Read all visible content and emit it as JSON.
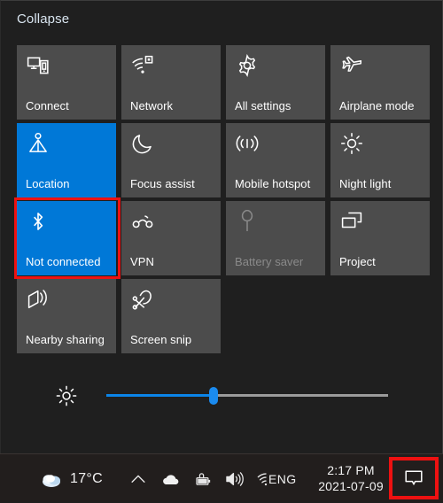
{
  "action_center": {
    "collapse_label": "Collapse",
    "colors": {
      "panel_background": "#1f1f1f",
      "tile_off": "#4c4c4c",
      "tile_on": "#0078d7",
      "accent": "#0078d7",
      "highlight_box": "#ee1111",
      "disabled_text": "#8a8a8a"
    },
    "tiles": [
      {
        "label": "Connect",
        "icon": "connect-icon",
        "state": "off"
      },
      {
        "label": "Network",
        "icon": "network-wifi-icon",
        "state": "off"
      },
      {
        "label": "All settings",
        "icon": "gear-icon",
        "state": "off"
      },
      {
        "label": "Airplane mode",
        "icon": "airplane-icon",
        "state": "off"
      },
      {
        "label": "Location",
        "icon": "location-person-icon",
        "state": "on"
      },
      {
        "label": "Focus assist",
        "icon": "moon-icon",
        "state": "off"
      },
      {
        "label": "Mobile hotspot",
        "icon": "hotspot-icon",
        "state": "off"
      },
      {
        "label": "Night light",
        "icon": "sun-icon",
        "state": "off"
      },
      {
        "label": "Not connected",
        "icon": "bluetooth-icon",
        "state": "on",
        "highlighted": true
      },
      {
        "label": "VPN",
        "icon": "vpn-icon",
        "state": "off"
      },
      {
        "label": "Battery saver",
        "icon": "battery-leaf-icon",
        "state": "disabled"
      },
      {
        "label": "Project",
        "icon": "project-screens-icon",
        "state": "off"
      },
      {
        "label": "Nearby sharing",
        "icon": "nearby-share-icon",
        "state": "off"
      },
      {
        "label": "Screen snip",
        "icon": "screen-snip-icon",
        "state": "off"
      },
      {
        "label": "",
        "icon": "",
        "state": "empty"
      },
      {
        "label": "",
        "icon": "",
        "state": "empty"
      }
    ],
    "brightness": {
      "icon": "brightness-sun-icon",
      "value_percent": 38
    }
  },
  "taskbar": {
    "weather": {
      "icon": "weather-cloud-icon",
      "temperature": "17°C"
    },
    "tray": [
      {
        "name": "show-hidden-icons-chevron-icon"
      },
      {
        "name": "onedrive-cloud-icon"
      },
      {
        "name": "battery-charging-icon"
      },
      {
        "name": "volume-speaker-icon"
      },
      {
        "name": "wifi-signal-icon"
      }
    ],
    "language": "ENG",
    "clock": {
      "time": "2:17 PM",
      "date": "2021-07-09"
    },
    "action_center_button": {
      "icon": "action-center-speech-bubble-icon",
      "highlighted": true
    }
  }
}
